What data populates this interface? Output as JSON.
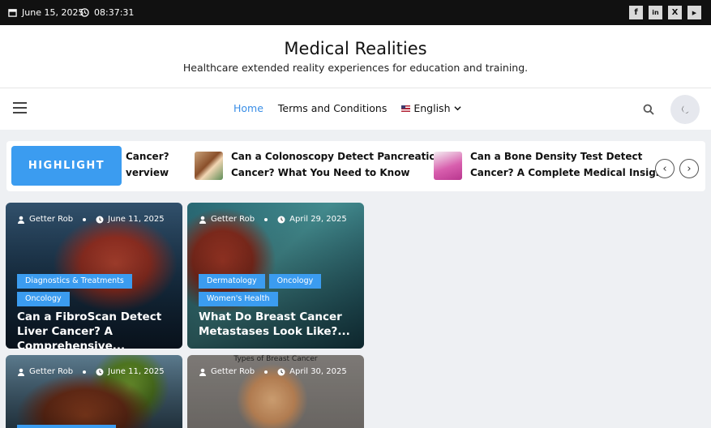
{
  "topbar": {
    "date": "June 15, 2025",
    "time": "08:37:31",
    "social": [
      "facebook-icon",
      "linkedin-icon",
      "x-icon",
      "youtube-icon"
    ],
    "social_glyphs": [
      "f",
      "in",
      "X",
      "▶"
    ]
  },
  "header": {
    "title": "Medical Realities",
    "tagline": "Healthcare extended reality experiences for education and training."
  },
  "nav": {
    "items": [
      "Home",
      "Terms and Conditions"
    ],
    "language": "English"
  },
  "ticker": {
    "label": "HIGHLIGHT",
    "items": [
      {
        "line1": "Cancer?",
        "line2": "verview"
      },
      {
        "line1": "Can a Colonoscopy Detect Pancreatic",
        "line2": "Cancer? What You Need to Know"
      },
      {
        "line1": "Can a Bone Density Test Detect",
        "line2": "Cancer? A Complete Medical Insight"
      }
    ]
  },
  "cards": [
    {
      "author": "Getter Rob",
      "date": "June 11, 2025",
      "categories": [
        "Diagnostics & Treatments",
        "Oncology"
      ],
      "title": "Can a FibroScan Detect Liver Cancer? A Comprehensive..."
    },
    {
      "author": "Getter Rob",
      "date": "April 29, 2025",
      "categories": [
        "Dermatology",
        "Oncology",
        "Women's Health"
      ],
      "title": "What Do Breast Cancer Metastases Look Like?..."
    },
    {
      "author": "Getter Rob",
      "date": "June 11, 2025",
      "categories": [],
      "title": ""
    },
    {
      "author": "Getter Rob",
      "date": "April 30, 2025",
      "categories": [],
      "title": "",
      "image_caption": "Types of Breast Cancer"
    }
  ],
  "colors": {
    "accent": "#3b9cf0",
    "topbar": "#111111"
  }
}
